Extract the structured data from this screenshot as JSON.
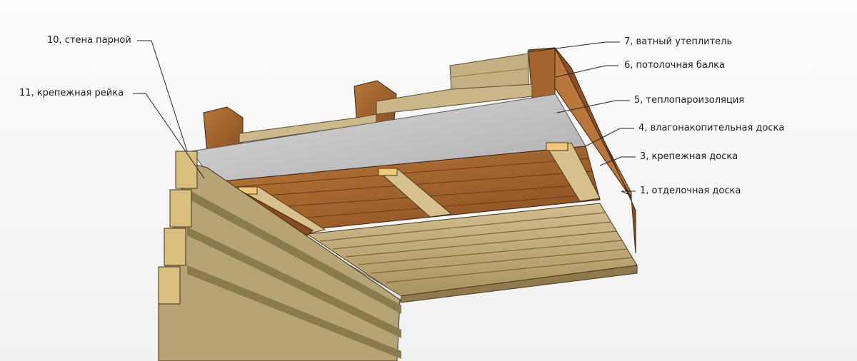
{
  "labels": {
    "wall": "10, стена парной",
    "rail": "11, крепежная рейка",
    "insulation": "7, ватный утеплитель",
    "beam": "6, потолочная балка",
    "vapor": "5, теплопароизоляция",
    "moisture_board": "4, влагонакопительная доска",
    "mount_board": "3, крепежная доска",
    "finish_board": "1, отделочная доска"
  },
  "colors": {
    "pine_light": "#c8b483",
    "pine_mid": "#a99460",
    "beam_brown": "#a0622f",
    "beam_dark": "#6e3d1a",
    "insulation_bg": "#b49a6a",
    "foil": "#c9c9cc",
    "end_grain": "#f0c877"
  }
}
